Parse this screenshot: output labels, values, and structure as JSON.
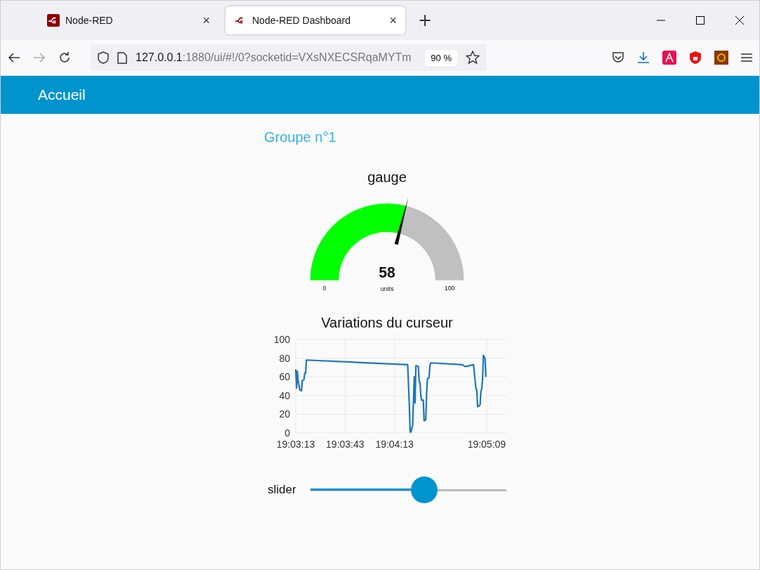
{
  "browser": {
    "tabs": [
      {
        "title": "Node-RED",
        "selected": false
      },
      {
        "title": "Node-RED Dashboard",
        "selected": true
      }
    ],
    "close_glyph": "×",
    "new_tab": "+",
    "url_host": "127.0.0.1",
    "url_rest": ":1880/ui/#!/0?socketid=VXsNXECSRqaMYTm",
    "zoom": "90 %"
  },
  "header": {
    "title": "Accueil"
  },
  "group": {
    "title": "Groupe n°1",
    "gauge": {
      "title": "gauge",
      "value": "58",
      "units": "units",
      "min": "0",
      "max": "100",
      "level": 0.58
    },
    "chart": {
      "chart_data": {
        "type": "line",
        "title": "Variations du curseur",
        "x": [
          68593,
          68593.5,
          68594,
          68594.5,
          68595.5,
          68596.5,
          68597,
          68598,
          68598.5,
          68599,
          68599.5,
          68661,
          68662,
          68662.5,
          68663,
          68664,
          68664.5,
          68665,
          68665.5,
          68666,
          68667.5,
          68668,
          68668.5,
          68669,
          68669.5,
          68670.5,
          68671,
          68672,
          68672.5,
          68673,
          68674,
          68674.5,
          68675,
          68694,
          68696,
          68701,
          68702.5,
          68703,
          68703.5,
          68705,
          68705.5,
          68706,
          68706.5,
          68707,
          68708,
          68708.5
        ],
        "series": [
          {
            "color": "#1f77b4",
            "values": [
              68,
              48,
              66,
              55,
              46,
              45,
              56,
              57,
              64,
              64,
              78,
              73,
              31,
              1,
              1,
              8,
              32,
              60,
              32,
              72,
              71,
              55,
              54,
              40,
              35,
              35,
              13,
              14,
              41,
              58,
              59,
              72,
              75,
              73,
              71,
              73,
              47,
              46,
              28,
              30,
              45,
              47,
              57,
              83,
              80,
              60
            ]
          }
        ],
        "grid": true,
        "xlim": [
          68593,
          68721
        ],
        "ylim": [
          0,
          100
        ],
        "xticks": [
          {
            "value": 68593,
            "label": "19:03:13"
          },
          {
            "value": 68623,
            "label": "19:03:43"
          },
          {
            "value": 68653,
            "label": "19:04:13"
          },
          {
            "value": 68709,
            "label": "19:05:09"
          }
        ],
        "yticks": [
          0,
          20,
          40,
          60,
          80,
          100
        ]
      }
    },
    "slider": {
      "label": "slider",
      "level": 0.58
    }
  }
}
